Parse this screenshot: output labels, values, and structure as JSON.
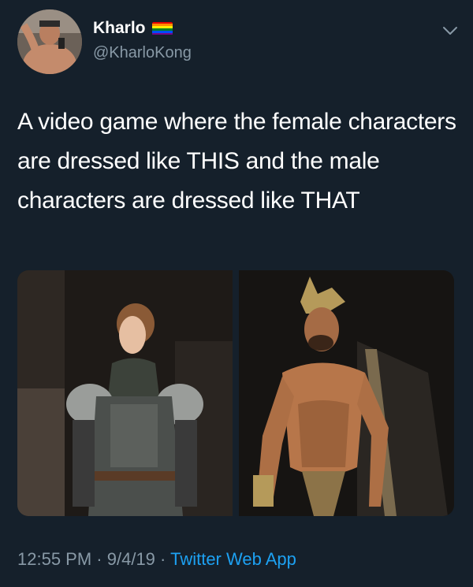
{
  "tweet": {
    "author": {
      "display_name": "Kharlo",
      "handle": "@KharloKong",
      "flag_icon": "rainbow-flag-icon",
      "flag_colors": [
        "#e40303",
        "#ff8c00",
        "#ffed00",
        "#008026",
        "#004dff",
        "#750787"
      ]
    },
    "text": "A video game where the female characters are dressed like THIS and the male characters are dressed like THAT",
    "media": [
      {
        "icon": "photo-female-knight-armor"
      },
      {
        "icon": "photo-male-gladiator-shirtless"
      }
    ],
    "time": "12:55 PM",
    "separator": "·",
    "date": "9/4/19",
    "source": "Twitter Web App",
    "menu_icon": "chevron-down-icon"
  },
  "colors": {
    "background": "#15202b",
    "secondary_text": "#8899a6",
    "link": "#1da1f2"
  }
}
